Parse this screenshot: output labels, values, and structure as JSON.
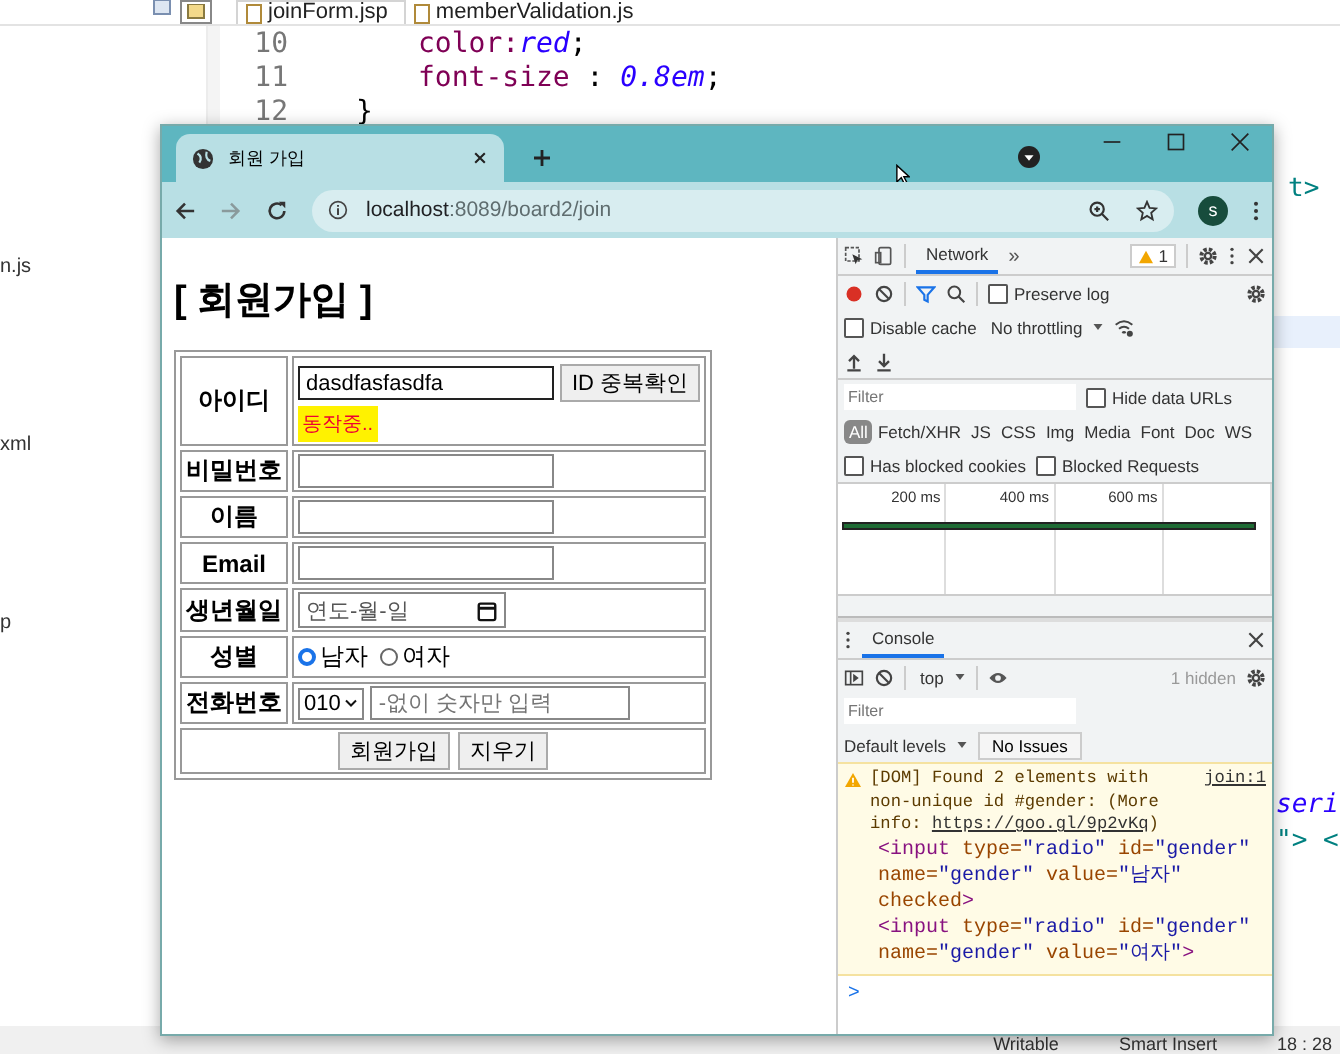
{
  "ide": {
    "editor_tabs": [
      {
        "label": "joinForm.jsp",
        "selected": true
      },
      {
        "label": "memberValidation.js",
        "selected": false
      }
    ],
    "code_lines": [
      {
        "number": "10",
        "kind": "declaration",
        "tokens": [
          {
            "kind": "prop",
            "text": "color:"
          },
          {
            "kind": "value",
            "text": "red"
          },
          {
            "kind": "plain",
            "text": ";"
          }
        ]
      },
      {
        "number": "11",
        "kind": "declaration",
        "tokens": [
          {
            "kind": "prop",
            "text": "font-size"
          },
          {
            "kind": "plain",
            "text": " : "
          },
          {
            "kind": "value",
            "text": "0.8em"
          },
          {
            "kind": "plain",
            "text": ";"
          }
        ]
      },
      {
        "number": "12",
        "kind": "close",
        "tokens": [
          {
            "kind": "plain",
            "text": "}"
          }
        ]
      }
    ],
    "explorer_fragments": [
      "n.js",
      "xml",
      "p"
    ],
    "right_fragments": [
      {
        "kind": "tag",
        "text": "t>"
      },
      {
        "kind": "keyword",
        "text": "seri"
      },
      {
        "kind": "tag",
        "text": "\"> <"
      }
    ],
    "status_bar": [
      "Writable",
      "Smart Insert",
      "18 : 28"
    ]
  },
  "browser": {
    "tab_title": "회원 가입",
    "address_host": "localhost",
    "address_path": ":8089/board2/join",
    "profile": "s"
  },
  "page": {
    "heading": "[ 회원가입 ]",
    "rows": [
      {
        "kind": "id",
        "label": "아이디",
        "value": "dasdfasfasdfa",
        "button": "ID 중복확인",
        "status": "동작중.."
      },
      {
        "kind": "password",
        "label": "비밀번호"
      },
      {
        "kind": "text",
        "label": "이름"
      },
      {
        "kind": "text",
        "label": "Email"
      },
      {
        "kind": "date",
        "label": "생년월일",
        "placeholder": "연도-월-일"
      },
      {
        "kind": "radio",
        "label": "성별",
        "options": [
          {
            "label": "남자",
            "selected": true
          },
          {
            "label": "여자",
            "selected": false
          }
        ]
      },
      {
        "kind": "phone",
        "label": "전화번호",
        "prefix": "010",
        "placeholder": "-없이 숫자만 입력"
      }
    ],
    "actions": [
      "회원가입",
      "지우기"
    ]
  },
  "devtools": {
    "tabs": [
      {
        "label": "Network",
        "selected": true
      }
    ],
    "more": "»",
    "warnings": "1",
    "preserve_log": {
      "label": "Preserve log",
      "checked": false
    },
    "disable_cache": {
      "label": "Disable cache",
      "checked": false
    },
    "throttling": "No throttling",
    "filter_placeholder": "Filter",
    "hide_data_urls": {
      "label": "Hide data URLs",
      "checked": false
    },
    "type_filters": [
      {
        "label": "All",
        "selected": true
      },
      {
        "label": "Fetch/XHR",
        "selected": false
      },
      {
        "label": "JS",
        "selected": false
      },
      {
        "label": "CSS",
        "selected": false
      },
      {
        "label": "Img",
        "selected": false
      },
      {
        "label": "Media",
        "selected": false
      },
      {
        "label": "Font",
        "selected": false
      },
      {
        "label": "Doc",
        "selected": false
      },
      {
        "label": "WS",
        "selected": false
      }
    ],
    "blocked": [
      {
        "label": "Has blocked cookies",
        "checked": false
      },
      {
        "label": "Blocked Requests",
        "checked": false
      }
    ],
    "timeline_ticks": [
      "200 ms",
      "400 ms",
      "600 ms"
    ],
    "console": {
      "tab": {
        "label": "Console",
        "selected": true
      },
      "context": "top",
      "hidden": "1 hidden",
      "filter_placeholder": "Filter",
      "levels": "Default levels",
      "issues": "No Issues",
      "message": {
        "text": "[DOM] Found 2 elements with non-unique id #gender: (More info: ",
        "link": "https://goo.gl/9p2vKq",
        "after": ")",
        "source": "join:1",
        "lines": [
          [
            {
              "kind": "tag",
              "text": "<input"
            },
            {
              "kind": "attr",
              "text": " type="
            },
            {
              "kind": "val",
              "text": "\"radio\""
            },
            {
              "kind": "attr",
              "text": " id="
            },
            {
              "kind": "val",
              "text": "\"gender\""
            },
            {
              "kind": "attr",
              "text": " name="
            },
            {
              "kind": "val",
              "text": "\"gender\""
            },
            {
              "kind": "attr",
              "text": " value="
            },
            {
              "kind": "val",
              "text": "\"남자\""
            },
            {
              "kind": "attr",
              "text": " checked"
            },
            {
              "kind": "tag",
              "text": ">"
            }
          ],
          [
            {
              "kind": "tag",
              "text": "<input"
            },
            {
              "kind": "attr",
              "text": " type="
            },
            {
              "kind": "val",
              "text": "\"radio\""
            },
            {
              "kind": "attr",
              "text": " id="
            },
            {
              "kind": "val",
              "text": "\"gender\""
            },
            {
              "kind": "attr",
              "text": " name="
            },
            {
              "kind": "val",
              "text": "\"gender\""
            },
            {
              "kind": "attr",
              "text": " value="
            },
            {
              "kind": "val",
              "text": "\"여자\""
            },
            {
              "kind": "tag",
              "text": ">"
            }
          ]
        ]
      },
      "prompt": ">"
    }
  }
}
